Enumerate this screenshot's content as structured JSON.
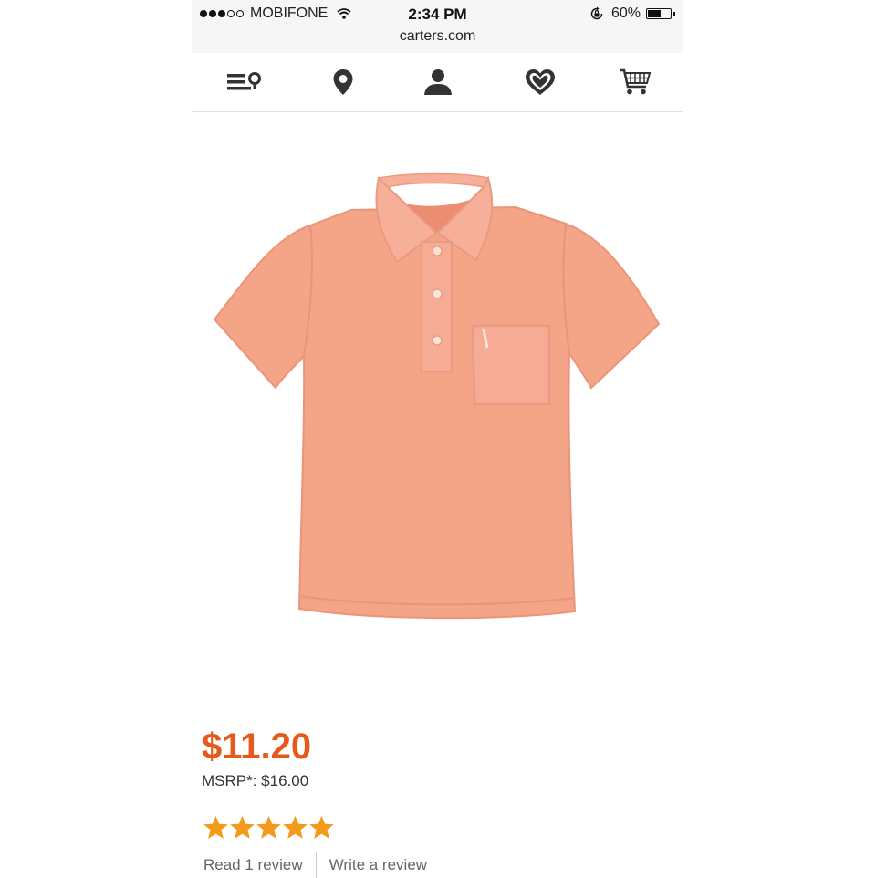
{
  "status_bar": {
    "carrier": "MOBIFONE",
    "time": "2:34 PM",
    "battery_percent": "60%",
    "battery_level": 0.6,
    "url": "carters.com"
  },
  "nav": {
    "icons": [
      "menu-search-icon",
      "location-pin-icon",
      "account-icon",
      "heart-icon",
      "cart-icon"
    ]
  },
  "product": {
    "image": "orange-polo-shirt",
    "color": "#f4a487",
    "price": "$11.20",
    "msrp": "MSRP*: $16.00",
    "rating": 5,
    "rating_max": 5,
    "read_review": "Read 1 review",
    "write_review": "Write a review"
  },
  "colors": {
    "price": "#e55a1b",
    "star": "#f39a1c",
    "icon": "#333333"
  }
}
